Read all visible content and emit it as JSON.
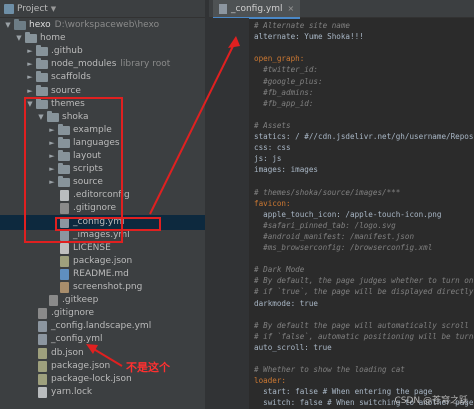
{
  "project_panel": {
    "title": "Project",
    "tree": [
      {
        "label": "hexo",
        "hint": "D:\\workspaceweb\\hexo",
        "icon": "folder-icon",
        "arrow": "▼",
        "kind": "folder"
      },
      {
        "label": "home",
        "hint": "",
        "icon": "folder-icon",
        "arrow": "▼",
        "kind": "folder"
      },
      {
        "label": ".github",
        "hint": "",
        "icon": "folder-icon",
        "arrow": "►",
        "kind": "folder"
      },
      {
        "label": "node_modules",
        "hint": "library root",
        "icon": "folder-icon",
        "arrow": "►",
        "kind": "folder"
      },
      {
        "label": "scaffolds",
        "hint": "",
        "icon": "folder-icon",
        "arrow": "►",
        "kind": "folder"
      },
      {
        "label": "source",
        "hint": "",
        "icon": "folder-icon",
        "arrow": "►",
        "kind": "folder"
      },
      {
        "label": "themes",
        "hint": "",
        "icon": "folder-icon",
        "arrow": "▼",
        "kind": "folder"
      },
      {
        "label": "shoka",
        "hint": "",
        "icon": "folder-icon",
        "arrow": "▼",
        "kind": "folder"
      },
      {
        "label": "example",
        "hint": "",
        "icon": "folder-icon",
        "arrow": "►",
        "kind": "folder"
      },
      {
        "label": "languages",
        "hint": "",
        "icon": "folder-icon",
        "arrow": "►",
        "kind": "folder"
      },
      {
        "label": "layout",
        "hint": "",
        "icon": "folder-icon",
        "arrow": "►",
        "kind": "folder"
      },
      {
        "label": "scripts",
        "hint": "",
        "icon": "folder-icon",
        "arrow": "►",
        "kind": "folder"
      },
      {
        "label": "source",
        "hint": "",
        "icon": "folder-icon",
        "arrow": "►",
        "kind": "folder"
      },
      {
        "label": ".editorconfig",
        "hint": "",
        "icon": "file-icon",
        "arrow": "",
        "kind": "file"
      },
      {
        "label": ".gitignore",
        "hint": "",
        "icon": "file-icon",
        "arrow": "",
        "kind": "git"
      },
      {
        "label": "_config.yml",
        "hint": "",
        "icon": "yaml-file-icon",
        "arrow": "",
        "kind": "yml",
        "selected": true
      },
      {
        "label": "_images.yml",
        "hint": "",
        "icon": "yaml-file-icon",
        "arrow": "",
        "kind": "yml"
      },
      {
        "label": "LICENSE",
        "hint": "",
        "icon": "file-icon",
        "arrow": "",
        "kind": "lic"
      },
      {
        "label": "package.json",
        "hint": "",
        "icon": "json-file-icon",
        "arrow": "",
        "kind": "json"
      },
      {
        "label": "README.md",
        "hint": "",
        "icon": "markdown-file-icon",
        "arrow": "",
        "kind": "md"
      },
      {
        "label": "screenshot.png",
        "hint": "",
        "icon": "image-file-icon",
        "arrow": "",
        "kind": "png"
      },
      {
        "label": ".gitkeep",
        "hint": "",
        "icon": "file-icon",
        "arrow": "",
        "kind": "git"
      },
      {
        "label": ".gitignore",
        "hint": "",
        "icon": "file-icon",
        "arrow": "",
        "kind": "git"
      },
      {
        "label": "_config.landscape.yml",
        "hint": "",
        "icon": "yaml-file-icon",
        "arrow": "",
        "kind": "yml"
      },
      {
        "label": "_config.yml",
        "hint": "",
        "icon": "yaml-file-icon",
        "arrow": "",
        "kind": "yml"
      },
      {
        "label": "db.json",
        "hint": "",
        "icon": "json-file-icon",
        "arrow": "",
        "kind": "json"
      },
      {
        "label": "package.json",
        "hint": "",
        "icon": "json-file-icon",
        "arrow": "",
        "kind": "json"
      },
      {
        "label": "package-lock.json",
        "hint": "",
        "icon": "json-file-icon",
        "arrow": "",
        "kind": "json"
      },
      {
        "label": "yarn.lock",
        "hint": "",
        "icon": "lock-file-icon",
        "arrow": "",
        "kind": "file"
      }
    ]
  },
  "editor": {
    "tab_label": "_config.yml",
    "lines": [
      {
        "t": "# Alternate site name",
        "c": "cm"
      },
      {
        "t": "alternate: Yume Shoka!!!",
        "c": "v"
      },
      {
        "t": "",
        "c": "v"
      },
      {
        "t": "open_graph:",
        "c": "k"
      },
      {
        "t": "  #twitter_id:",
        "c": "cm"
      },
      {
        "t": "  #google_plus:",
        "c": "cm"
      },
      {
        "t": "  #fb_admins:",
        "c": "cm"
      },
      {
        "t": "  #fb_app_id:",
        "c": "cm"
      },
      {
        "t": "",
        "c": "v"
      },
      {
        "t": "# Assets",
        "c": "cm"
      },
      {
        "t": "statics: / #//cdn.jsdelivr.net/gh/username/Reposi",
        "c": "v"
      },
      {
        "t": "css: css",
        "c": "v"
      },
      {
        "t": "js: js",
        "c": "v"
      },
      {
        "t": "images: images",
        "c": "v"
      },
      {
        "t": "",
        "c": "v"
      },
      {
        "t": "# themes/shoka/source/images/***",
        "c": "cm"
      },
      {
        "t": "favicon:",
        "c": "k"
      },
      {
        "t": "  apple_touch_icon: /apple-touch-icon.png",
        "c": "v"
      },
      {
        "t": "  #safari_pinned_tab: /logo.svg",
        "c": "cm"
      },
      {
        "t": "  #android_manifest: /manifest.json",
        "c": "cm"
      },
      {
        "t": "  #ms_browserconfig: /browserconfig.xml",
        "c": "cm"
      },
      {
        "t": "",
        "c": "v"
      },
      {
        "t": "# Dark Mode",
        "c": "cm"
      },
      {
        "t": "# By default, the page judges whether to turn on",
        "c": "cm"
      },
      {
        "t": "# if `true`, the page will be displayed directly",
        "c": "cm"
      },
      {
        "t": "darkmode: true",
        "c": "v"
      },
      {
        "t": "",
        "c": "v"
      },
      {
        "t": "# By default the page will automatically scroll t",
        "c": "cm"
      },
      {
        "t": "# if `false`, automatic positioning will be turne",
        "c": "cm"
      },
      {
        "t": "auto_scroll: true",
        "c": "v"
      },
      {
        "t": "",
        "c": "v"
      },
      {
        "t": "# Whether to show the loading cat",
        "c": "cm"
      },
      {
        "t": "loader:",
        "c": "k"
      },
      {
        "t": "  start: false # When entering the page",
        "c": "v"
      },
      {
        "t": "  switch: false # When switching to another page",
        "c": "v"
      }
    ]
  },
  "annotation": {
    "text": "不是这个"
  },
  "watermark": "CSDN @苍穹之跃",
  "colors": {
    "annotation": "#e02020",
    "selection": "#0d293e"
  }
}
